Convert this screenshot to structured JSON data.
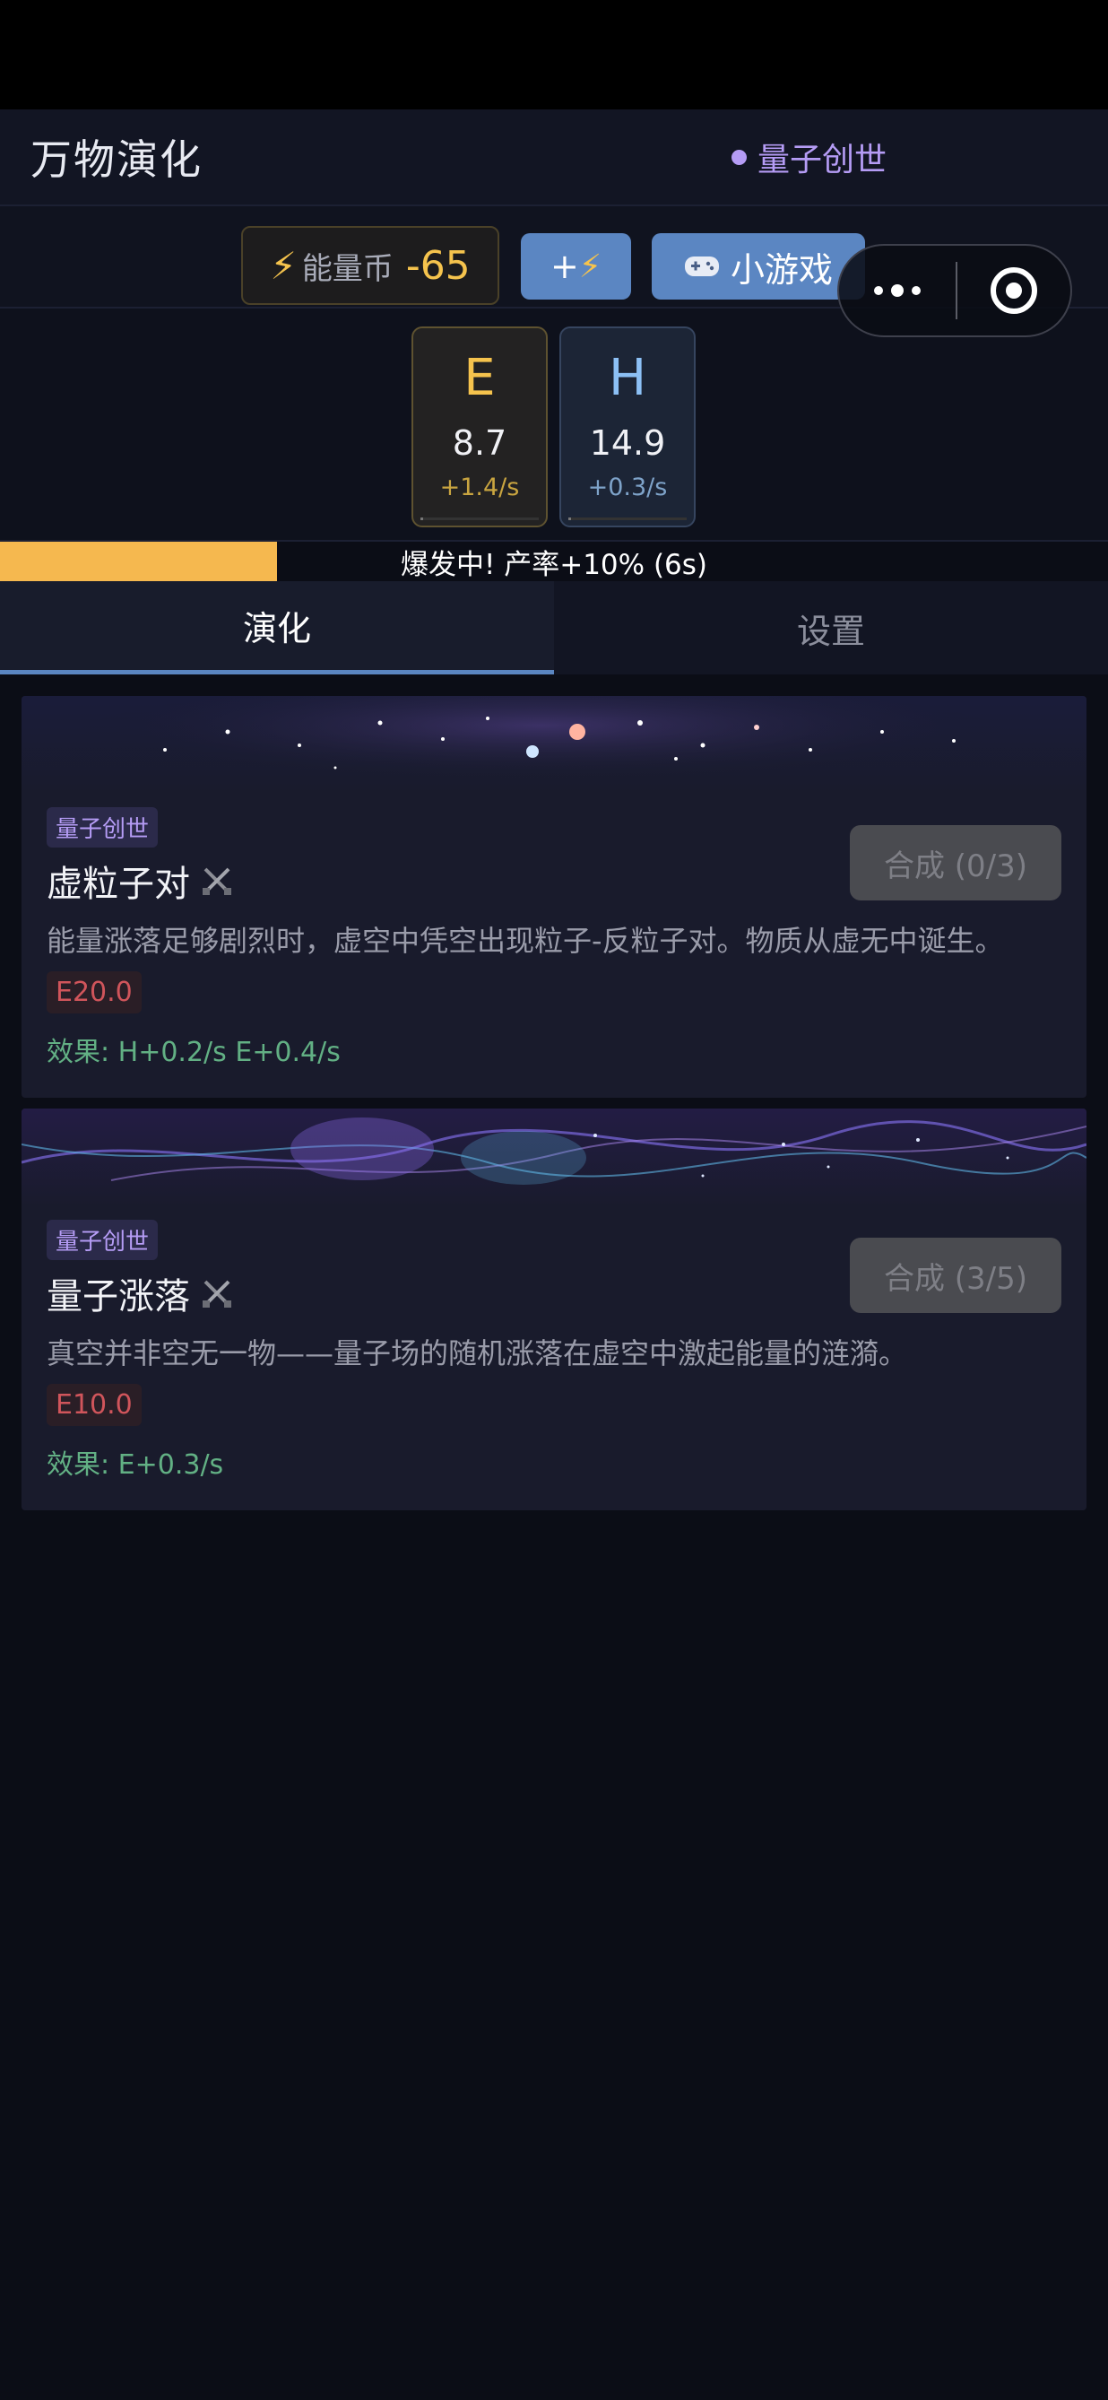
{
  "header": {
    "title": "万物演化",
    "era": "量子创世"
  },
  "toolbar": {
    "coin_label": "能量币",
    "coin_value": "-65",
    "boost_label": "+",
    "game_label": "小游戏"
  },
  "resources": [
    {
      "symbol": "E",
      "amount": "8.7",
      "rate": "+1.4/s"
    },
    {
      "symbol": "H",
      "amount": "14.9",
      "rate": "+0.3/s"
    }
  ],
  "burst": {
    "text": "爆发中! 产率+10% (6s)",
    "progress": 0.25
  },
  "tabs": [
    "演化",
    "设置"
  ],
  "cards": [
    {
      "tag": "量子创世",
      "title": "虚粒子对",
      "desc": "能量涨落足够剧烈时，虚空中凭空出现粒子-反粒子对。物质从虚无中诞生。",
      "cost": "E20.0",
      "effect": "效果: H+0.2/s  E+0.4/s",
      "button": "合成 (0/3)"
    },
    {
      "tag": "量子创世",
      "title": "量子涨落",
      "desc": "真空并非空无一物——量子场的随机涨落在虚空中激起能量的涟漪。",
      "cost": "E10.0",
      "effect": "效果: E+0.3/s",
      "button": "合成 (3/5)"
    }
  ],
  "colors": {
    "accent_blue": "#5b86c2",
    "energy_gold": "#f5c34d",
    "era_purple": "#b59cf5",
    "effect_green": "#62b084",
    "cost_red": "#d0555b"
  }
}
